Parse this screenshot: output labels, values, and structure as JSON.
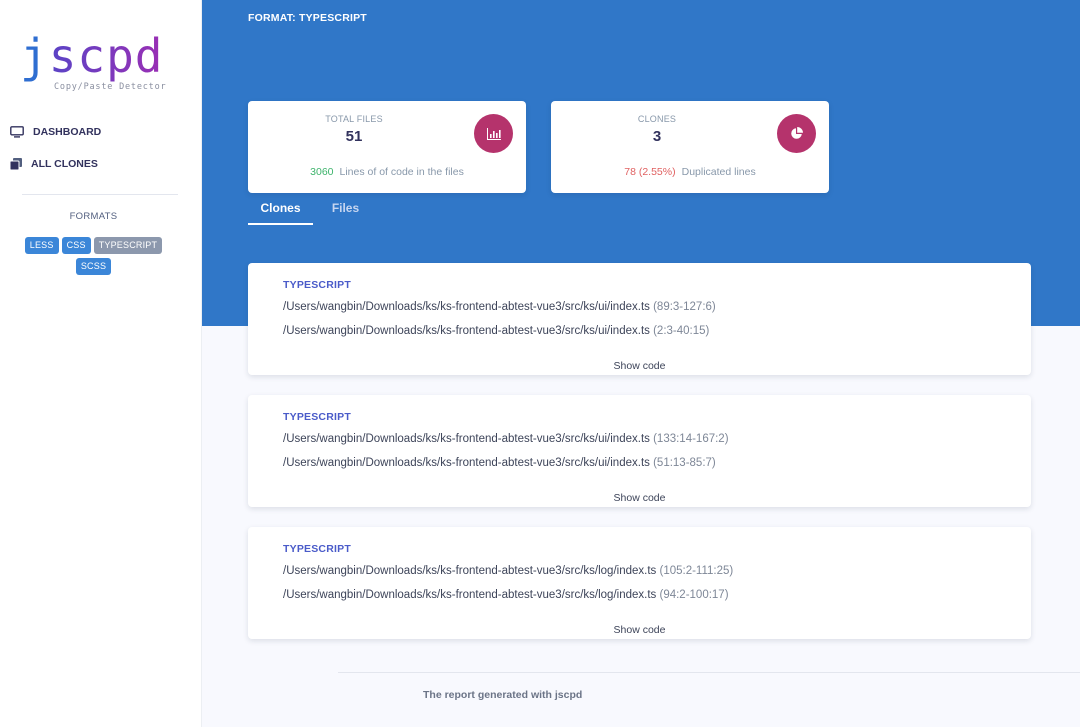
{
  "logo": {
    "j": "j",
    "rest": "scpd",
    "subtitle": "Copy/Paste Detector"
  },
  "nav": {
    "dashboard": "DASHBOARD",
    "all_clones": "ALL CLONES"
  },
  "formats": {
    "title": "FORMATS",
    "items": [
      "LESS",
      "CSS",
      "TYPESCRIPT",
      "SCSS"
    ],
    "active": "TYPESCRIPT"
  },
  "header": {
    "format_title": "FORMAT: TYPESCRIPT"
  },
  "stats": {
    "total_files": {
      "label": "TOTAL FILES",
      "value": "51",
      "foot_value": "3060",
      "foot_text": "Lines of of code in the files"
    },
    "clones": {
      "label": "CLONES",
      "value": "3",
      "foot_value": "78 (2.55%)",
      "foot_text": "Duplicated lines"
    }
  },
  "tabs": [
    "Clones",
    "Files"
  ],
  "clones": [
    {
      "format": "TYPESCRIPT",
      "a_path": "/Users/wangbin/Downloads/ks/ks-frontend-abtest-vue3/src/ks/ui/index.ts",
      "a_range": "(89:3-127:6)",
      "b_path": "/Users/wangbin/Downloads/ks/ks-frontend-abtest-vue3/src/ks/ui/index.ts",
      "b_range": "(2:3-40:15)",
      "show_code": "Show code"
    },
    {
      "format": "TYPESCRIPT",
      "a_path": "/Users/wangbin/Downloads/ks/ks-frontend-abtest-vue3/src/ks/ui/index.ts",
      "a_range": "(133:14-167:2)",
      "b_path": "/Users/wangbin/Downloads/ks/ks-frontend-abtest-vue3/src/ks/ui/index.ts",
      "b_range": "(51:13-85:7)",
      "show_code": "Show code"
    },
    {
      "format": "TYPESCRIPT",
      "a_path": "/Users/wangbin/Downloads/ks/ks-frontend-abtest-vue3/src/ks/log/index.ts",
      "a_range": "(105:2-111:25)",
      "b_path": "/Users/wangbin/Downloads/ks/ks-frontend-abtest-vue3/src/ks/log/index.ts",
      "b_range": "(94:2-100:17)",
      "show_code": "Show code"
    }
  ],
  "footer": "The report generated with jscpd",
  "icons": {
    "dashboard": "monitor-icon",
    "all_clones": "copy-icon",
    "total_files": "bar-chart-icon",
    "clones": "pie-chart-icon"
  },
  "colors": {
    "primary_blue": "#3077c8",
    "icon_magenta": "#b5336c",
    "positive_green": "#3db36b",
    "negative_red": "#e06161"
  }
}
